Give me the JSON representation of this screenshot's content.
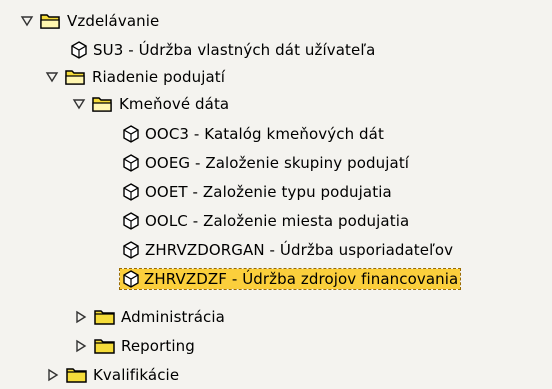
{
  "tree": {
    "nodes": [
      {
        "label": "Vzdelávanie",
        "type": "folder",
        "state": "expanded",
        "icon": "folder-open-icon"
      },
      {
        "label": "SU3 - Údržba vlastných dát užívateľa",
        "type": "transaction",
        "icon": "transaction-cube-icon"
      },
      {
        "label": "Riadenie podujatí",
        "type": "folder",
        "state": "expanded",
        "icon": "folder-open-icon"
      },
      {
        "label": "Kmeňové dáta",
        "type": "folder",
        "state": "expanded",
        "icon": "folder-open-icon"
      },
      {
        "label": "OOC3 - Katalóg kmeňových dát",
        "type": "transaction",
        "icon": "transaction-cube-icon"
      },
      {
        "label": "OOEG - Založenie skupiny podujatí",
        "type": "transaction",
        "icon": "transaction-cube-icon"
      },
      {
        "label": "OOET - Založenie typu podujatia",
        "type": "transaction",
        "icon": "transaction-cube-icon"
      },
      {
        "label": "OOLC - Založenie miesta podujatia",
        "type": "transaction",
        "icon": "transaction-cube-icon"
      },
      {
        "label": "ZHRVZDORGAN - Údržba usporiadateľov",
        "type": "transaction",
        "icon": "transaction-cube-icon"
      },
      {
        "label": "ZHRVZDZF - Údržba zdrojov financovania",
        "type": "transaction",
        "selected": true,
        "icon": "transaction-cube-icon"
      },
      {
        "label": "Administrácia",
        "type": "folder",
        "state": "collapsed",
        "icon": "folder-closed-icon"
      },
      {
        "label": "Reporting",
        "type": "folder",
        "state": "collapsed",
        "icon": "folder-closed-icon"
      },
      {
        "label": "Kvalifikácie",
        "type": "folder",
        "state": "collapsed",
        "icon": "folder-closed-icon"
      }
    ]
  },
  "colors": {
    "background": "#f4f3ef",
    "selection": "#fbcf3c",
    "folder": "#f5dc3a"
  }
}
